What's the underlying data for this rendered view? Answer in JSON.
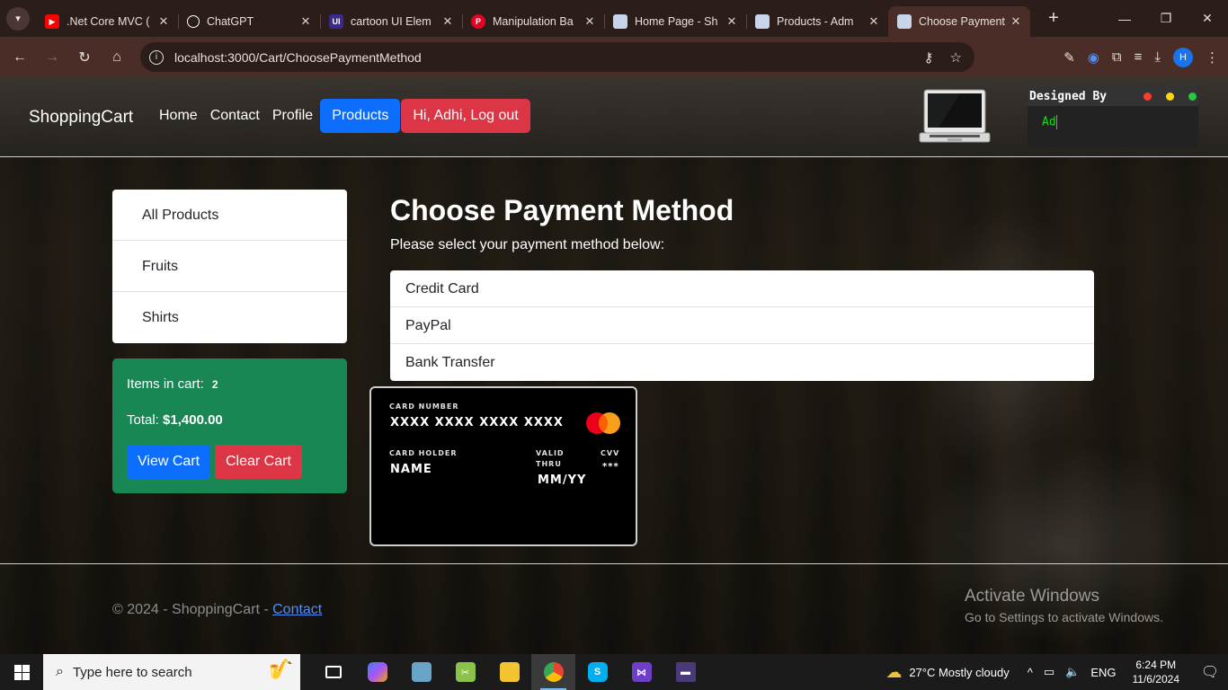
{
  "browser": {
    "tabs": [
      {
        "title": ".Net Core MVC (",
        "icon": "youtube-icon",
        "color": "#ff0000"
      },
      {
        "title": "ChatGPT",
        "icon": "chatgpt-icon",
        "color": "#ffffff"
      },
      {
        "title": "cartoon UI Elem",
        "icon": "uiverse-icon",
        "color": "#3b2a8a"
      },
      {
        "title": "Manipulation Ba",
        "icon": "pinterest-icon",
        "color": "#e60023"
      },
      {
        "title": "Home Page - Sh",
        "icon": "page-icon",
        "color": "#c8d4ea"
      },
      {
        "title": "Products - Adm",
        "icon": "page-icon",
        "color": "#c8d4ea"
      },
      {
        "title": "Choose Payment",
        "icon": "page-icon",
        "color": "#c8d4ea",
        "active": true
      }
    ],
    "url": "localhost:3000/Cart/ChoosePaymentMethod",
    "profile_initial": "H"
  },
  "navbar": {
    "brand": "ShoppingCart",
    "links": [
      "Home",
      "Contact",
      "Profile"
    ],
    "products_label": "Products",
    "logout_label": "Hi, Adhi, Log out",
    "terminal_title": "Designed By",
    "terminal_text": "Ad"
  },
  "sidebar": {
    "categories": [
      "All Products",
      "Fruits",
      "Shirts"
    ],
    "cart": {
      "items_label": "Items in cart:",
      "items_count": "2",
      "total_label": "Total:",
      "total_value": "$1,400.00",
      "view_label": "View Cart",
      "clear_label": "Clear Cart"
    }
  },
  "main": {
    "title": "Choose Payment Method",
    "subtitle": "Please select your payment method below:",
    "methods": [
      "Credit Card",
      "PayPal",
      "Bank Transfer"
    ],
    "card": {
      "number_label": "CARD NUMBER",
      "number_value": "XXXX XXXX XXXX XXXX",
      "holder_label": "CARD HOLDER",
      "holder_value": "NAME",
      "valid_label_1": "VALID",
      "valid_label_2": "THRU",
      "valid_value": "MM/YY",
      "cvv_label": "CVV",
      "cvv_value": "***"
    }
  },
  "footer": {
    "copyright": "© 2024 - ShoppingCart - ",
    "contact_link": "Contact"
  },
  "watermark": {
    "line1": "Activate Windows",
    "line2": "Go to Settings to activate Windows."
  },
  "taskbar": {
    "search_placeholder": "Type here to search",
    "weather": "27°C  Mostly cloudy",
    "language": "ENG",
    "time": "6:24 PM",
    "date": "11/6/2024"
  },
  "colors": {
    "primary": "#0d6efd",
    "danger": "#dc3545",
    "success": "#198754"
  }
}
